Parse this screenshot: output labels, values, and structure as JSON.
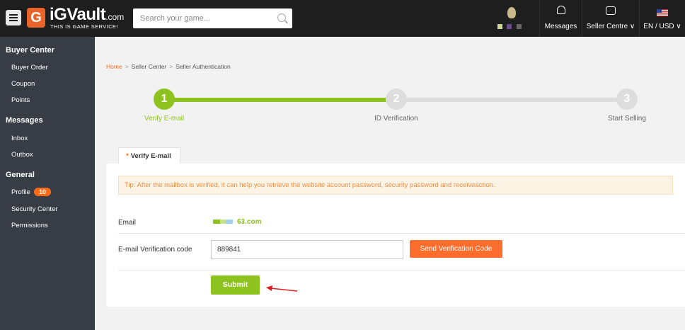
{
  "header": {
    "logo_mark": "G",
    "logo_name": "iGVault",
    "logo_suffix": ".com",
    "logo_tagline": "THIS IS GAME SERVICE!",
    "search_placeholder": "Search your game...",
    "nav": [
      {
        "label": "Messages",
        "icon": "bell-icon"
      },
      {
        "label": "Seller Centre ∨",
        "icon": "store-icon"
      },
      {
        "label": "EN / USD ∨",
        "icon": "us-flag-icon"
      }
    ]
  },
  "sidebar": {
    "sections": [
      {
        "title": "Buyer Center",
        "items": [
          {
            "label": "Buyer Order"
          },
          {
            "label": "Coupon"
          },
          {
            "label": "Points"
          }
        ]
      },
      {
        "title": "Messages",
        "items": [
          {
            "label": "Inbox"
          },
          {
            "label": "Outbox"
          }
        ]
      },
      {
        "title": "General",
        "items": [
          {
            "label": "Profile",
            "badge": "10"
          },
          {
            "label": "Security Center"
          },
          {
            "label": "Permissions"
          }
        ]
      }
    ]
  },
  "breadcrumb": {
    "items": [
      "Home",
      "Seller Center",
      "Seller Authentication"
    ],
    "separator": ">"
  },
  "steps": [
    {
      "number": "1",
      "label": "Verify E-mail",
      "active": true
    },
    {
      "number": "2",
      "label": "ID Verification",
      "active": false
    },
    {
      "number": "3",
      "label": "Start Selling",
      "active": false
    }
  ],
  "tab": {
    "required_mark": "*",
    "label": "Verify E-mail"
  },
  "form": {
    "tip": "Tip: After the mailbox is verified, it can help you retrieve the website account password, security password and receiveaction.",
    "email_label": "Email",
    "email_value": "63.com",
    "code_label": "E-mail Verification code",
    "code_value": "889841",
    "send_button": "Send Verification Code",
    "submit_button": "Submit"
  },
  "colors": {
    "accent_green": "#8dc21f",
    "accent_orange": "#ff6a17",
    "topbar": "#1e1e1e",
    "sidebar": "#383d45",
    "annotation_arrow": "#e02020"
  }
}
